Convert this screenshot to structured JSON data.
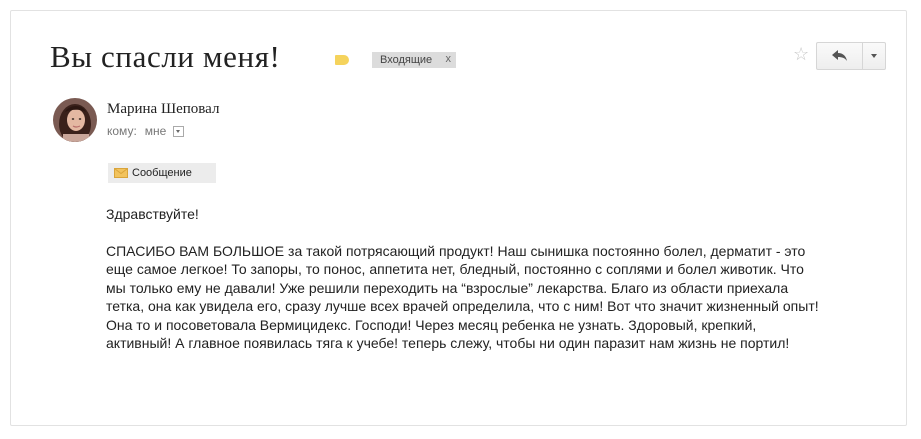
{
  "email": {
    "subject": "Вы спасли меня!",
    "label_chip": "Входящие",
    "label_chip_close": "x",
    "sender_name": "Марина Шеповал",
    "recipient_prefix": "кому:",
    "recipient": "мне",
    "message_chip": "Сообщение",
    "greeting": "Здравствуйте!",
    "body_lines": [
      "СПАСИБО ВАМ БОЛЬШОЕ за такой потрясающий продукт! Наш сынишка постоянно болел, дерматит - это",
      "еще самое легкое! То запоры, то понос, аппетита нет, бледный, постоянно с соплями и болел животик. Что",
      "мы только ему не давали! Уже решили переходить на “взрослые” лекарства. Благо из области приехала",
      "тетка, она как увидела его, сразу лучше всех врачей определила, что с ним! Вот что значит жизненный опыт!",
      "Она то и посоветовала Вермицидекс. Господи! Через месяц ребенка не узнать. Здоровый, крепкий,",
      "активный! А главное появилась тяга к учебе! теперь слежу, чтобы ни один паразит нам жизнь не портил!"
    ]
  },
  "icons": {
    "label": "label-tag-icon",
    "star": "star-icon",
    "reply": "reply-arrow-icon",
    "more": "chevron-down-icon",
    "envelope": "envelope-icon"
  },
  "colors": {
    "label_tag": "#f5d35c",
    "chip_bg": "#dcdcdc",
    "text": "#222222",
    "muted": "#777777"
  }
}
